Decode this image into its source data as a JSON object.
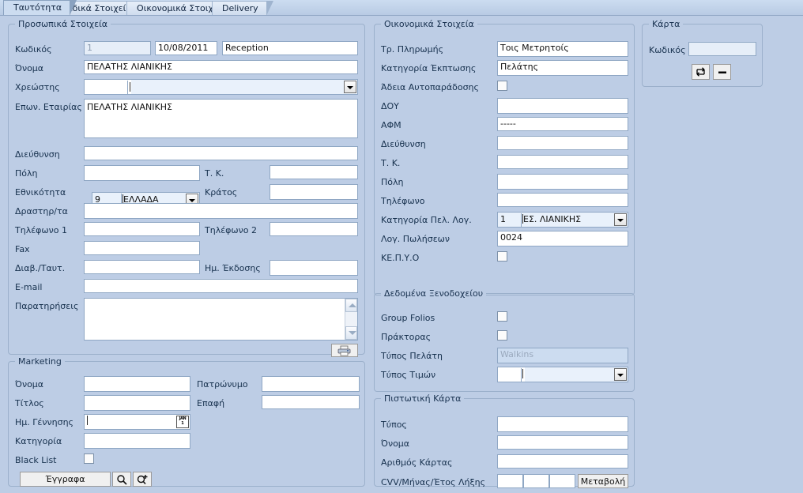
{
  "tabs": [
    {
      "label": "Ταυτότητα",
      "active": true
    },
    {
      "label": "Ειδικά Στοιχεία",
      "active": false
    },
    {
      "label": "Οικονομικά Στοιχεία",
      "active": false
    },
    {
      "label": "Delivery",
      "active": false
    }
  ],
  "personal": {
    "legend": "Προσωπικά Στοιχεία",
    "code_label": "Κωδικός",
    "code_value": "1",
    "date_value": "10/08/2011",
    "source_value": "Reception",
    "name_label": "Όνομα",
    "name_value": "ΠΕΛΑΤΗΣ ΛΙΑΝΙΚΗΣ",
    "debtor_label": "Χρεώστης",
    "debtor_code": "",
    "debtor_value": "",
    "company_label": "Επων. Εταιρίας",
    "company_value": "ΠΕΛΑΤΗΣ ΛΙΑΝΙΚΗΣ",
    "address_label": "Διεύθυνση",
    "address_value": "",
    "city_label": "Πόλη",
    "city_value": "",
    "zip_label": "Τ. Κ.",
    "zip_value": "",
    "nationality_label": "Εθνικότητα",
    "nationality_code": "9",
    "nationality_value": "ΕΛΛΑΔΑ",
    "country_label": "Κράτος",
    "country_value": "",
    "activity_label": "Δραστηρ/τα",
    "activity_value": "",
    "phone1_label": "Τηλέφωνο 1",
    "phone1_value": "",
    "phone2_label": "Τηλέφωνο 2",
    "phone2_value": "",
    "fax_label": "Fax",
    "fax_value": "",
    "passport_label": "Διαβ./Ταυτ.",
    "passport_value": "",
    "issue_label": "Ημ. Έκδοσης",
    "issue_value": "",
    "email_label": "E-mail",
    "email_value": "",
    "notes_label": "Παρατηρήσεις",
    "notes_value": "",
    "print_icon": "printer-icon"
  },
  "marketing": {
    "legend": "Marketing",
    "name_label": "Όνομα",
    "name_value": "",
    "father_label": "Πατρώνυμο",
    "father_value": "",
    "title_label": "Τίτλος",
    "title_value": "",
    "contact_label": "Επαφή",
    "contact_value": "",
    "birth_label": "Ημ. Γέννησης",
    "birth_value": "",
    "category_label": "Κατηγορία",
    "category_value": "",
    "blacklist_label": "Black List",
    "blacklist_checked": false,
    "docs_button": "Έγγραφα",
    "search_icon": "magnifier-icon",
    "search_add_icon": "magnifier-plus-icon"
  },
  "financial": {
    "legend": "Οικονομικά Στοιχεία",
    "payment_label": "Τρ. Πληρωμής",
    "payment_value": "Τοις Μετρητοίς",
    "discount_label": "Κατηγορία Έκπτωσης",
    "discount_value": "Πελάτης",
    "selfdelivery_label": "Άδεια Αυτοπαράδοσης",
    "selfdelivery_checked": false,
    "doy_label": "ΔΟΥ",
    "doy_value": "",
    "afm_label": "ΑΦΜ",
    "afm_value": "-----",
    "address_label": "Διεύθυνση",
    "address_value": "",
    "zip_label": "Τ. Κ.",
    "zip_value": "",
    "city_label": "Πόλη",
    "city_value": "",
    "phone_label": "Τηλέφωνο",
    "phone_value": "",
    "custcat_label": "Κατηγορία Πελ. Λογ.",
    "custcat_code": "1",
    "custcat_value": "ΕΣ. ΛΙΑΝΙΚΗΣ",
    "salesacc_label": "Λογ. Πωλήσεων",
    "salesacc_value": "0024",
    "kepyo_label": "ΚΕ.Π.Υ.Ο",
    "kepyo_checked": false
  },
  "hotel": {
    "legend": "Δεδομένα Ξενοδοχείου",
    "groupfolios_label": "Group Folios",
    "groupfolios_checked": false,
    "agent_label": "Πράκτορας",
    "agent_checked": false,
    "custtype_label": "Τύπος Πελάτη",
    "custtype_value": "Walkins",
    "pricetype_label": "Τύπος Τιμών",
    "pricetype_code": "",
    "pricetype_value": ""
  },
  "creditcard": {
    "legend": "Πιστωτική Κάρτα",
    "type_label": "Τύπος",
    "type_value": "",
    "name_label": "Όνομα",
    "name_value": "",
    "number_label": "Αριθμός Κάρτας",
    "number_value": "",
    "cvv_label": "CVV/Μήνας/Έτος Λήξης",
    "cvv_value": "",
    "month_value": "",
    "year_value": "",
    "change_button": "Μεταβολή"
  },
  "card": {
    "legend": "Κάρτα",
    "code_label": "Κωδικός",
    "code_value": "",
    "swap_icon": "swap-arrows-icon",
    "minus_icon": "minus-icon"
  },
  "colors": {
    "background": "#bdcde5",
    "panel_border": "#9bb0cb",
    "field_border": "#8fa7c4",
    "field_bg": "#ffffff",
    "readonly_bg": "#e6eef8",
    "text": "#16304d"
  }
}
